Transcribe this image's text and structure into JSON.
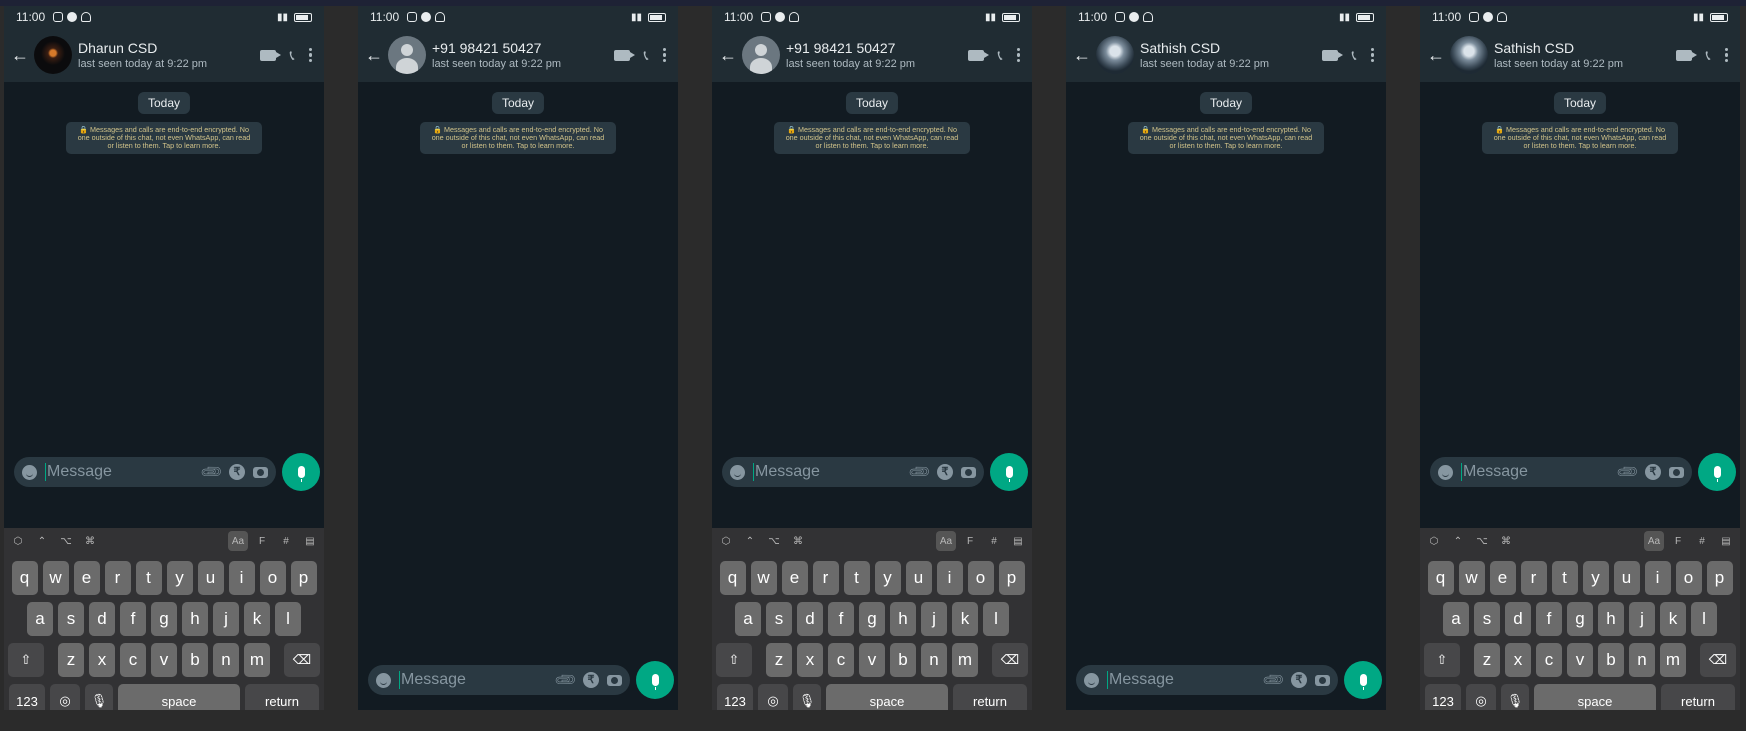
{
  "status": {
    "time": "11:00"
  },
  "common": {
    "last_seen": "last seen today at 9:22 pm",
    "today": "Today",
    "encryption": "🔒 Messages and calls are end-to-end encrypted. No one outside of this chat, not even WhatsApp, can read or listen to them. Tap to learn more.",
    "placeholder": "Message",
    "rupee": "₹"
  },
  "phones": [
    {
      "contact": "Dharun CSD",
      "avatar": "dark-photo",
      "keyboard": true
    },
    {
      "contact": "+91 98421 50427",
      "avatar": "default-person",
      "keyboard": false
    },
    {
      "contact": "+91 98421 50427",
      "avatar": "default-person",
      "keyboard": true
    },
    {
      "contact": "Sathish CSD",
      "avatar": "photo",
      "keyboard": false
    },
    {
      "contact": "Sathish CSD",
      "avatar": "photo",
      "keyboard": true
    }
  ],
  "keyboard": {
    "toolbar_right": [
      "Aa",
      "F",
      "#",
      "▤"
    ],
    "row1": [
      "q",
      "w",
      "e",
      "r",
      "t",
      "y",
      "u",
      "i",
      "o",
      "p"
    ],
    "row2": [
      "a",
      "s",
      "d",
      "f",
      "g",
      "h",
      "j",
      "k",
      "l"
    ],
    "row3": [
      "z",
      "x",
      "c",
      "v",
      "b",
      "n",
      "m"
    ],
    "num_label": "123",
    "space_label": "space",
    "return_label": "return"
  },
  "colors": {
    "accent": "#00a884",
    "header": "#202c33",
    "background": "#121b22"
  }
}
